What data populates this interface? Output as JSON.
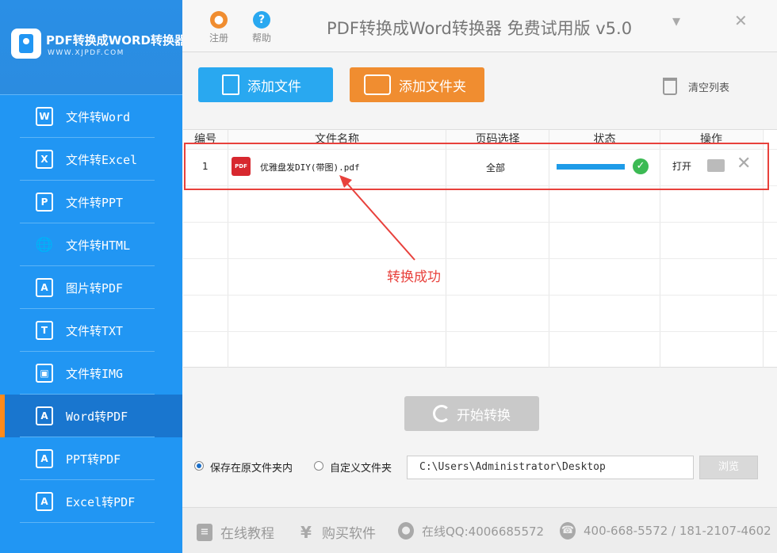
{
  "app": {
    "logo_title": "PDF转换成WORD转换器",
    "logo_url": "WWW.XJPDF.COM",
    "window_title": "PDF转换成Word转换器 免费试用版 v5.0",
    "register_label": "注册",
    "help_label": "帮助"
  },
  "sidebar": {
    "items": [
      {
        "label": "文件转Word",
        "icon": "W"
      },
      {
        "label": "文件转Excel",
        "icon": "X"
      },
      {
        "label": "文件转PPT",
        "icon": "P"
      },
      {
        "label": "文件转HTML",
        "icon": "🌐"
      },
      {
        "label": "图片转PDF",
        "icon": "A"
      },
      {
        "label": "文件转TXT",
        "icon": "T"
      },
      {
        "label": "文件转IMG",
        "icon": "▣"
      },
      {
        "label": "Word转PDF",
        "icon": "A"
      },
      {
        "label": "PPT转PDF",
        "icon": "A"
      },
      {
        "label": "Excel转PDF",
        "icon": "A"
      }
    ],
    "active_index": 7
  },
  "toolbar": {
    "add_file": "添加文件",
    "add_folder": "添加文件夹",
    "clear_list": "清空列表"
  },
  "table": {
    "headers": [
      "编号",
      "文件名称",
      "页码选择",
      "状态",
      "操作"
    ],
    "rows": [
      {
        "index": "1",
        "filename": "优雅盘发DIY(带图).pdf",
        "pages": "全部",
        "progress": 1.0,
        "status": "success",
        "action_open": "打开"
      }
    ],
    "pdf_badge": "PDF"
  },
  "annotation": {
    "text": "转换成功",
    "color": "#e8413c"
  },
  "convert_button": "开始转换",
  "save_options": {
    "original_folder": "保存在原文件夹内",
    "custom_folder": "自定义文件夹",
    "selected": "original_folder",
    "path_value": "C:\\Users\\Administrator\\Desktop",
    "browse": "浏览"
  },
  "footer": {
    "tutorial": "在线教程",
    "buy": "购买软件",
    "qq": "在线QQ:4006685572",
    "phone": "400-668-5572 / 181-2107-4602"
  },
  "colors": {
    "sidebar": "#2196f3",
    "active": "#1976cf",
    "accent_orange": "#f08d30",
    "accent_blue": "#29a8f0"
  }
}
